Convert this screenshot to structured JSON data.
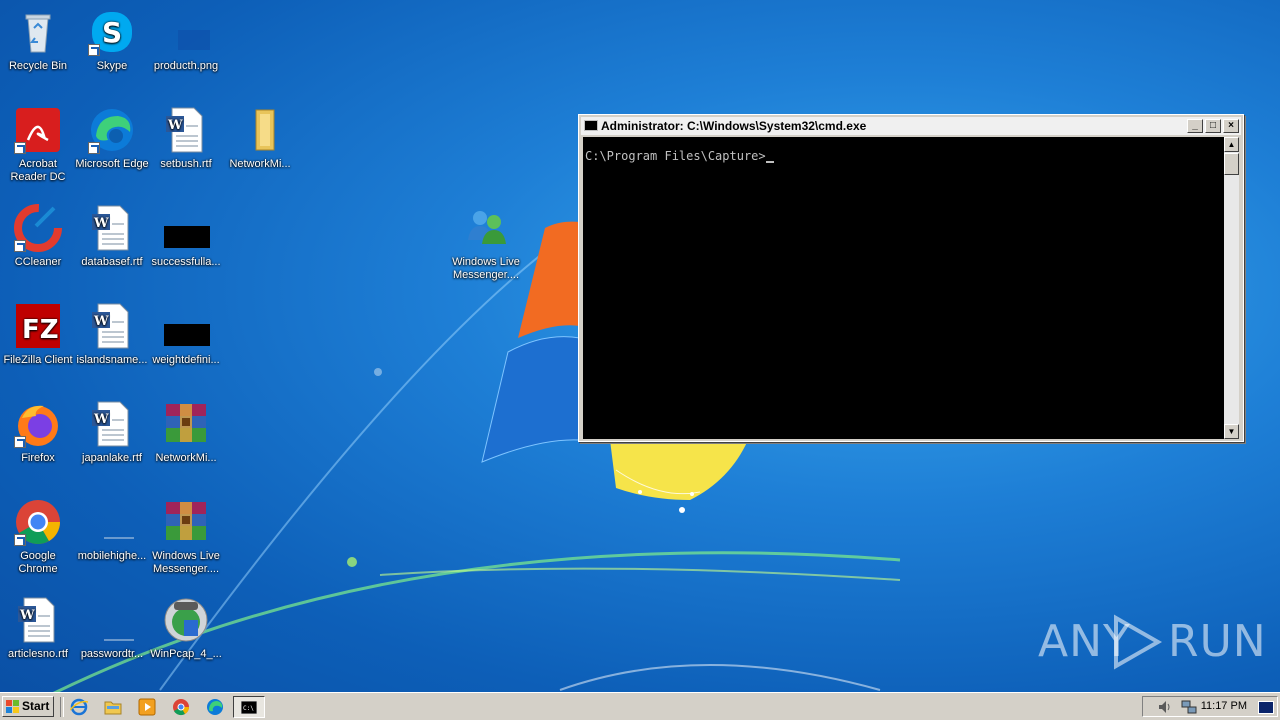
{
  "desktop": {
    "icons": [
      {
        "label": "Recycle Bin",
        "icon": "recycle-bin-icon"
      },
      {
        "label": "Skype",
        "icon": "skype-icon"
      },
      {
        "label": "producth.png",
        "icon": "image-file-icon"
      },
      {
        "label": "Acrobat Reader DC",
        "icon": "acrobat-icon"
      },
      {
        "label": "Microsoft Edge",
        "icon": "edge-icon"
      },
      {
        "label": "setbush.rtf",
        "icon": "word-doc-icon"
      },
      {
        "label": "NetworkMi...",
        "icon": "folder-icon"
      },
      {
        "label": "CCleaner",
        "icon": "ccleaner-icon"
      },
      {
        "label": "databasef.rtf",
        "icon": "word-doc-icon"
      },
      {
        "label": "successfulla...",
        "icon": "black-file-icon"
      },
      {
        "label": "Windows Live Messenger....",
        "icon": "messenger-icon"
      },
      {
        "label": "FileZilla Client",
        "icon": "filezilla-icon"
      },
      {
        "label": "islandsname...",
        "icon": "word-doc-icon"
      },
      {
        "label": "weightdefini...",
        "icon": "black-file-icon"
      },
      {
        "label": "Firefox",
        "icon": "firefox-icon"
      },
      {
        "label": "japanlake.rtf",
        "icon": "word-doc-icon"
      },
      {
        "label": "NetworkMi...",
        "icon": "winrar-icon"
      },
      {
        "label": "Google Chrome",
        "icon": "chrome-icon"
      },
      {
        "label": "mobilehighe...",
        "icon": "blank-file-icon"
      },
      {
        "label": "Windows Live Messenger....",
        "icon": "winrar-icon"
      },
      {
        "label": "articlesno.rtf",
        "icon": "word-doc-icon"
      },
      {
        "label": "passwordtr...",
        "icon": "blank-file-icon"
      },
      {
        "label": "WinPcap_4_...",
        "icon": "winpcap-icon"
      }
    ]
  },
  "cmd": {
    "title": "Administrator: C:\\Windows\\System32\\cmd.exe",
    "prompt": "C:\\Program Files\\Capture>",
    "minimize": "_",
    "maximize": "□",
    "close": "×",
    "scroll_up": "▲",
    "scroll_down": "▼"
  },
  "taskbar": {
    "start_label": "Start",
    "clock": "11:17 PM",
    "quick_launch": [
      "ie-icon",
      "explorer-icon",
      "media-player-icon",
      "chrome-icon",
      "edge-icon"
    ],
    "task_buttons": [
      "cmd-icon"
    ],
    "tray": [
      "volume-icon",
      "network-icon"
    ]
  },
  "watermark": {
    "text_left": "ANY",
    "text_right": "RUN"
  },
  "colors": {
    "desktop_bg": "#1e7fd6",
    "titlebar_active_start": "#0a246a",
    "titlebar_active_end": "#a6caf0",
    "console_bg": "#000000",
    "console_fg": "#c0c0c0",
    "taskbar_bg": "#d4d0c8"
  }
}
